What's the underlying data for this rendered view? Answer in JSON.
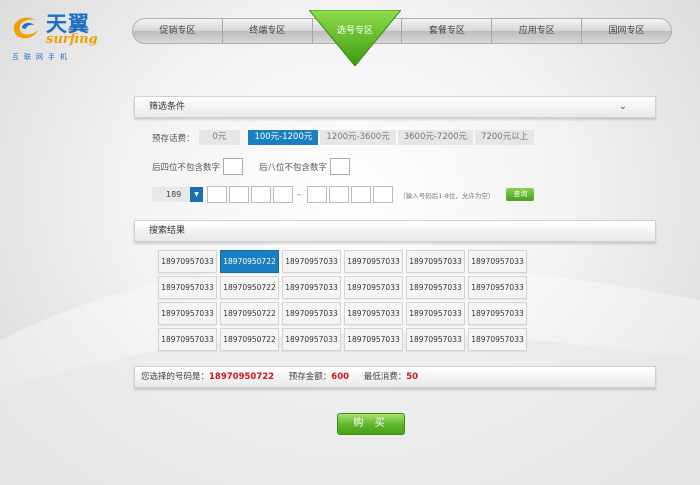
{
  "brand": {
    "cn": "天翼",
    "en": "surfing",
    "tagline": "互联网手机"
  },
  "nav": {
    "items": [
      "促销专区",
      "终端专区",
      "选号专区",
      "套餐专区",
      "应用专区",
      "国网专区"
    ],
    "active_index": 2
  },
  "filter": {
    "title": "筛选条件",
    "price_label": "预存话费：",
    "price_options": [
      "0元",
      "100元-1200元",
      "1200元-3600元",
      "3600元-7200元",
      "7200元以上"
    ],
    "selected_price_index": 1,
    "last4_label": "后四位不包含数字",
    "last8_label": "后八位不包含数字",
    "prefix_value": "189",
    "hint": "（输入号码后1-8位，允许为空）",
    "query_label": "查询"
  },
  "results": {
    "title": "搜索结果",
    "numbers": [
      [
        "18970957033",
        "18970950722",
        "18970957033",
        "18970957033",
        "18970957033",
        "18970957033"
      ],
      [
        "18970957033",
        "18970950722",
        "18970957033",
        "18970957033",
        "18970957033",
        "18970957033"
      ],
      [
        "18970957033",
        "18970950722",
        "18970957033",
        "18970957033",
        "18970957033",
        "18970957033"
      ],
      [
        "18970957033",
        "18970950722",
        "18970957033",
        "18970957033",
        "18970957033",
        "18970957033"
      ]
    ],
    "selected": {
      "row": 0,
      "col": 1
    }
  },
  "summary": {
    "selected_label": "您选择的号码是：",
    "selected_number": "18970950722",
    "deposit_label": "预存金额：",
    "deposit_value": "600",
    "min_label": "最低消费：",
    "min_value": "50"
  },
  "buy_label": "购 买",
  "colors": {
    "accent_blue": "#1a7fc1",
    "green": "#5cb52a",
    "red": "#c8161d",
    "brand_blue": "#1b6fc3",
    "brand_orange": "#f0a000"
  }
}
